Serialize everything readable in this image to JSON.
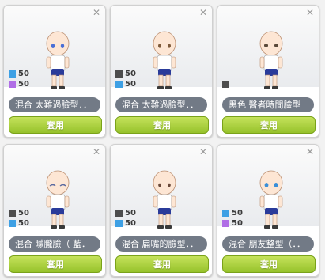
{
  "colors": {
    "blue": "#3ea0e4",
    "purple": "#b06ee6",
    "dark": "#4d4d4d",
    "apply_button": "#a8cf34",
    "name_pill": "#727a86"
  },
  "cards": [
    {
      "name": "混合 太難過臉型．．",
      "stats": [
        {
          "color": "#3ea0e4",
          "value": "50"
        },
        {
          "color": "#b06ee6",
          "value": "50"
        }
      ],
      "button": "套用",
      "eye_color": "#4a6fd6"
    },
    {
      "name": "混合 太難過臉型．．",
      "stats": [
        {
          "color": "#4d4d4d",
          "value": "50"
        },
        {
          "color": "#3ea0e4",
          "value": "50"
        }
      ],
      "button": "套用",
      "eye_color": "#7e5a3a"
    },
    {
      "name": "黑色 醫者時間臉型",
      "stats": [
        {
          "color": "#4d4d4d",
          "value": ""
        }
      ],
      "button": "套用",
      "eye_color": "#5a4a3a"
    },
    {
      "name": "混合 矇朧臉（ 藍．",
      "stats": [
        {
          "color": "#4d4d4d",
          "value": "50"
        },
        {
          "color": "#3ea0e4",
          "value": "50"
        }
      ],
      "button": "套用",
      "eye_color": "#5b6aa0"
    },
    {
      "name": "混合 扁嘴的臉型．．",
      "stats": [
        {
          "color": "#4d4d4d",
          "value": "50"
        },
        {
          "color": "#3ea0e4",
          "value": "50"
        }
      ],
      "button": "套用",
      "eye_color": "#6a4a3a"
    },
    {
      "name": "混合 朋友整型（．．",
      "stats": [
        {
          "color": "#3ea0e4",
          "value": "50"
        },
        {
          "color": "#b06ee6",
          "value": "50"
        }
      ],
      "button": "套用",
      "eye_color": "#3a8fd8"
    }
  ]
}
